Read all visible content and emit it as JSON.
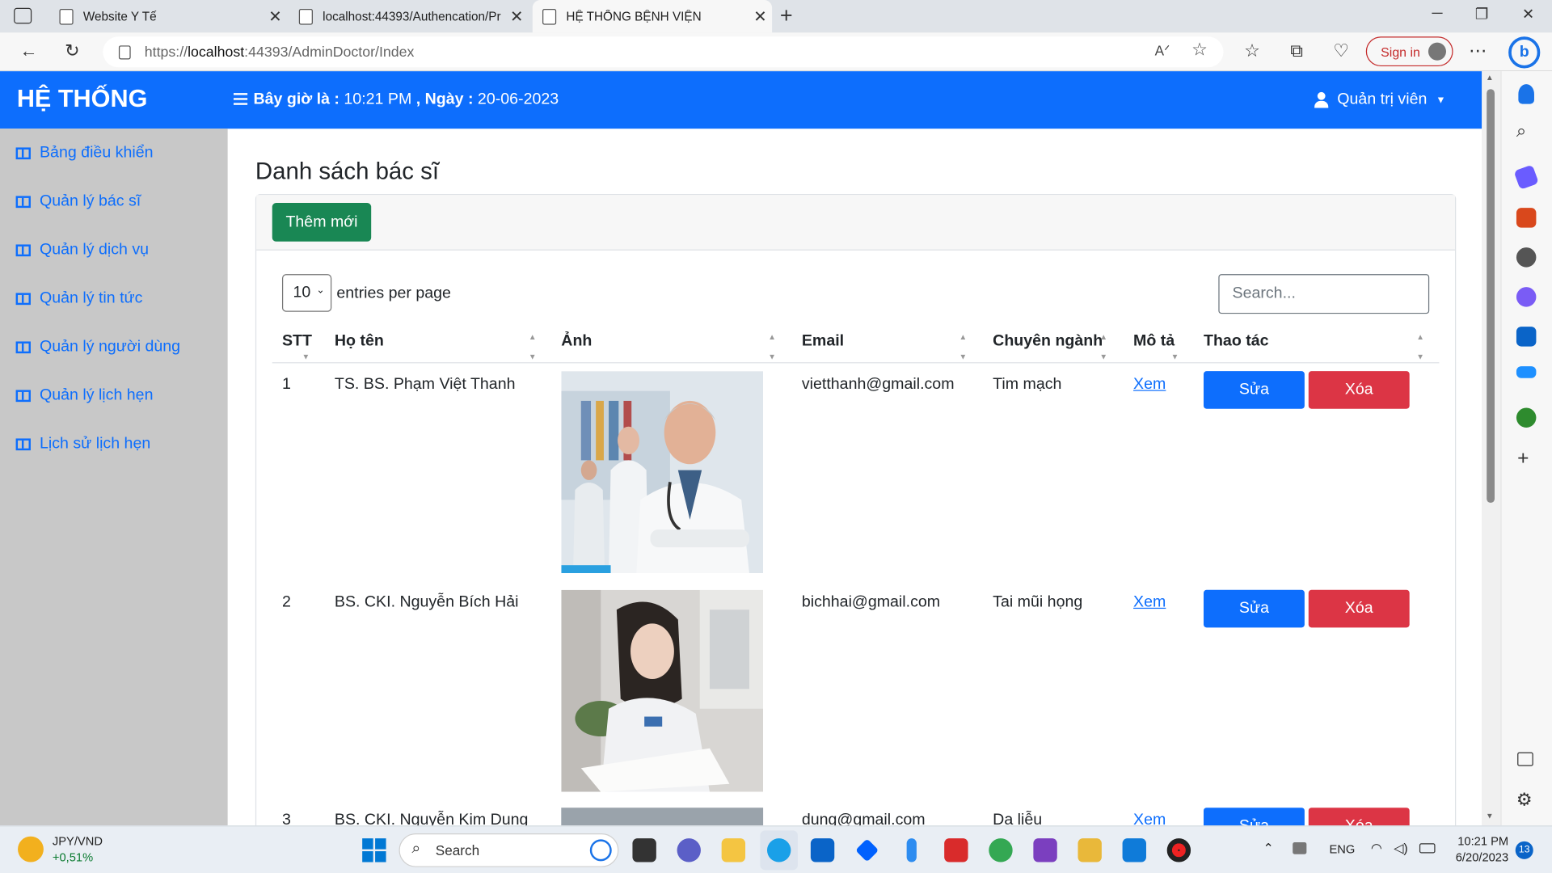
{
  "browser": {
    "tabs": [
      {
        "title": "Website Y Tế"
      },
      {
        "title": "localhost:44393/Authencation/Pr"
      },
      {
        "title": "HỆ THỐNG BỆNH VIỆN"
      }
    ],
    "url_prefix": "https://",
    "url_host": "localhost",
    "url_rest": ":44393/AdminDoctor/Index",
    "signin_label": "Sign in"
  },
  "header": {
    "brand": "HỆ THỐNG",
    "time_label": "Bây giờ là :",
    "time_value": "10:21 PM",
    "date_label": ", Ngày :",
    "date_value": "20-06-2023",
    "user_label": "Quản trị viên"
  },
  "sidebar": {
    "items": [
      {
        "label": "Bảng điều khiển"
      },
      {
        "label": "Quản lý bác sĩ"
      },
      {
        "label": "Quản lý dịch vụ"
      },
      {
        "label": "Quản lý tin tức"
      },
      {
        "label": "Quản lý người dùng"
      },
      {
        "label": "Quản lý lịch hẹn"
      },
      {
        "label": "Lịch sử lịch hẹn"
      }
    ]
  },
  "main": {
    "title": "Danh sách bác sĩ",
    "add_label": "Thêm mới",
    "per_page_value": "10",
    "per_page_label": "entries per page",
    "search_placeholder": "Search...",
    "columns": [
      "STT",
      "Họ tên",
      "Ảnh",
      "Email",
      "Chuyên ngành",
      "Mô tả",
      "Thao tác"
    ],
    "rows": [
      {
        "stt": "1",
        "name": "TS. BS. Phạm Việt Thanh",
        "email": "vietthanh@gmail.com",
        "specialty": "Tim mạch",
        "desc_link": "Xem",
        "edit": "Sửa",
        "delete": "Xóa"
      },
      {
        "stt": "2",
        "name": "BS. CKI. Nguyễn Bích Hải",
        "email": "bichhai@gmail.com",
        "specialty": "Tai mũi họng",
        "desc_link": "Xem",
        "edit": "Sửa",
        "delete": "Xóa"
      },
      {
        "stt": "3",
        "name": "BS. CKI. Nguyễn Kim Dung",
        "email": "dung@gmail.com",
        "specialty": "Da liễu",
        "desc_link": "Xem",
        "edit": "Sửa",
        "delete": "Xóa"
      }
    ]
  },
  "taskbar": {
    "ticker_symbol": "JPY/VND",
    "ticker_change": "+0,51%",
    "search_label": "Search",
    "lang": "ENG",
    "clock_time": "10:21 PM",
    "clock_date": "6/20/2023",
    "notif_count": "13"
  },
  "colors": {
    "primary": "#0d6efd",
    "success": "#198754",
    "danger": "#dc3545",
    "sidebar_bg": "#c8c8c8"
  }
}
